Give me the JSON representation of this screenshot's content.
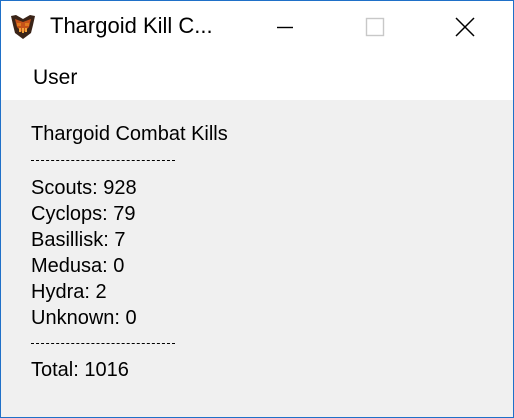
{
  "window": {
    "title": "Thargoid Kill C..."
  },
  "icons": {
    "app": "thargoid-app-icon",
    "minimize": "minimize-icon",
    "maximize": "maximize-icon",
    "close": "close-icon"
  },
  "menu": {
    "items": [
      {
        "label": "User"
      }
    ]
  },
  "content": {
    "heading": "Thargoid Combat Kills",
    "kills": [
      {
        "label": "Scouts: 928"
      },
      {
        "label": "Cyclops: 79"
      },
      {
        "label": "Basillisk: 7"
      },
      {
        "label": "Medusa: 0"
      },
      {
        "label": "Hydra: 2"
      },
      {
        "label": "Unknown: 0"
      }
    ],
    "total": "Total: 1016"
  },
  "colors": {
    "titlebar": "#ffffff",
    "content_background": "#f0f0f0",
    "window_border": "#1f70c8",
    "icon_dark": "#3a2418",
    "icon_orange": "#e07a1f"
  }
}
